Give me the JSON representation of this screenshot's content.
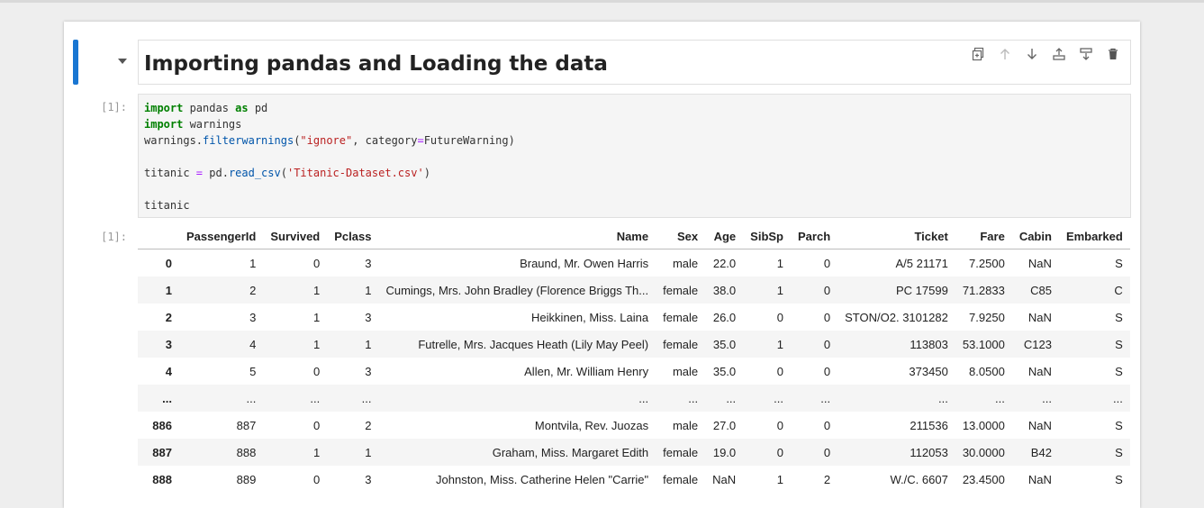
{
  "markdown": {
    "heading": "Importing pandas and Loading the data"
  },
  "toolbar": {
    "icons": [
      "duplicate-icon",
      "move-up-icon",
      "move-down-icon",
      "insert-above-icon",
      "insert-below-icon",
      "delete-icon"
    ]
  },
  "code_cell": {
    "prompt": "[1]:",
    "lines": [
      "import pandas as pd",
      "import warnings",
      "warnings.filterwarnings(\"ignore\", category=FutureWarning)",
      "",
      "titanic = pd.read_csv('Titanic-Dataset.csv')",
      "",
      "titanic"
    ]
  },
  "output_cell": {
    "prompt": "[1]:",
    "columns": [
      "",
      "PassengerId",
      "Survived",
      "Pclass",
      "Name",
      "Sex",
      "Age",
      "SibSp",
      "Parch",
      "Ticket",
      "Fare",
      "Cabin",
      "Embarked"
    ],
    "rows": [
      [
        "0",
        "1",
        "0",
        "3",
        "Braund, Mr. Owen Harris",
        "male",
        "22.0",
        "1",
        "0",
        "A/5 21171",
        "7.2500",
        "NaN",
        "S"
      ],
      [
        "1",
        "2",
        "1",
        "1",
        "Cumings, Mrs. John Bradley (Florence Briggs Th...",
        "female",
        "38.0",
        "1",
        "0",
        "PC 17599",
        "71.2833",
        "C85",
        "C"
      ],
      [
        "2",
        "3",
        "1",
        "3",
        "Heikkinen, Miss. Laina",
        "female",
        "26.0",
        "0",
        "0",
        "STON/O2. 3101282",
        "7.9250",
        "NaN",
        "S"
      ],
      [
        "3",
        "4",
        "1",
        "1",
        "Futrelle, Mrs. Jacques Heath (Lily May Peel)",
        "female",
        "35.0",
        "1",
        "0",
        "113803",
        "53.1000",
        "C123",
        "S"
      ],
      [
        "4",
        "5",
        "0",
        "3",
        "Allen, Mr. William Henry",
        "male",
        "35.0",
        "0",
        "0",
        "373450",
        "8.0500",
        "NaN",
        "S"
      ],
      [
        "...",
        "...",
        "...",
        "...",
        "...",
        "...",
        "...",
        "...",
        "...",
        "...",
        "...",
        "...",
        "..."
      ],
      [
        "886",
        "887",
        "0",
        "2",
        "Montvila, Rev. Juozas",
        "male",
        "27.0",
        "0",
        "0",
        "211536",
        "13.0000",
        "NaN",
        "S"
      ],
      [
        "887",
        "888",
        "1",
        "1",
        "Graham, Miss. Margaret Edith",
        "female",
        "19.0",
        "0",
        "0",
        "112053",
        "30.0000",
        "B42",
        "S"
      ],
      [
        "888",
        "889",
        "0",
        "3",
        "Johnston, Miss. Catherine Helen \"Carrie\"",
        "female",
        "NaN",
        "1",
        "2",
        "W./C. 6607",
        "23.4500",
        "NaN",
        "S"
      ]
    ]
  },
  "colors": {
    "active_bar": "#1976d2",
    "keyword": "#008000",
    "string": "#ba2121"
  }
}
